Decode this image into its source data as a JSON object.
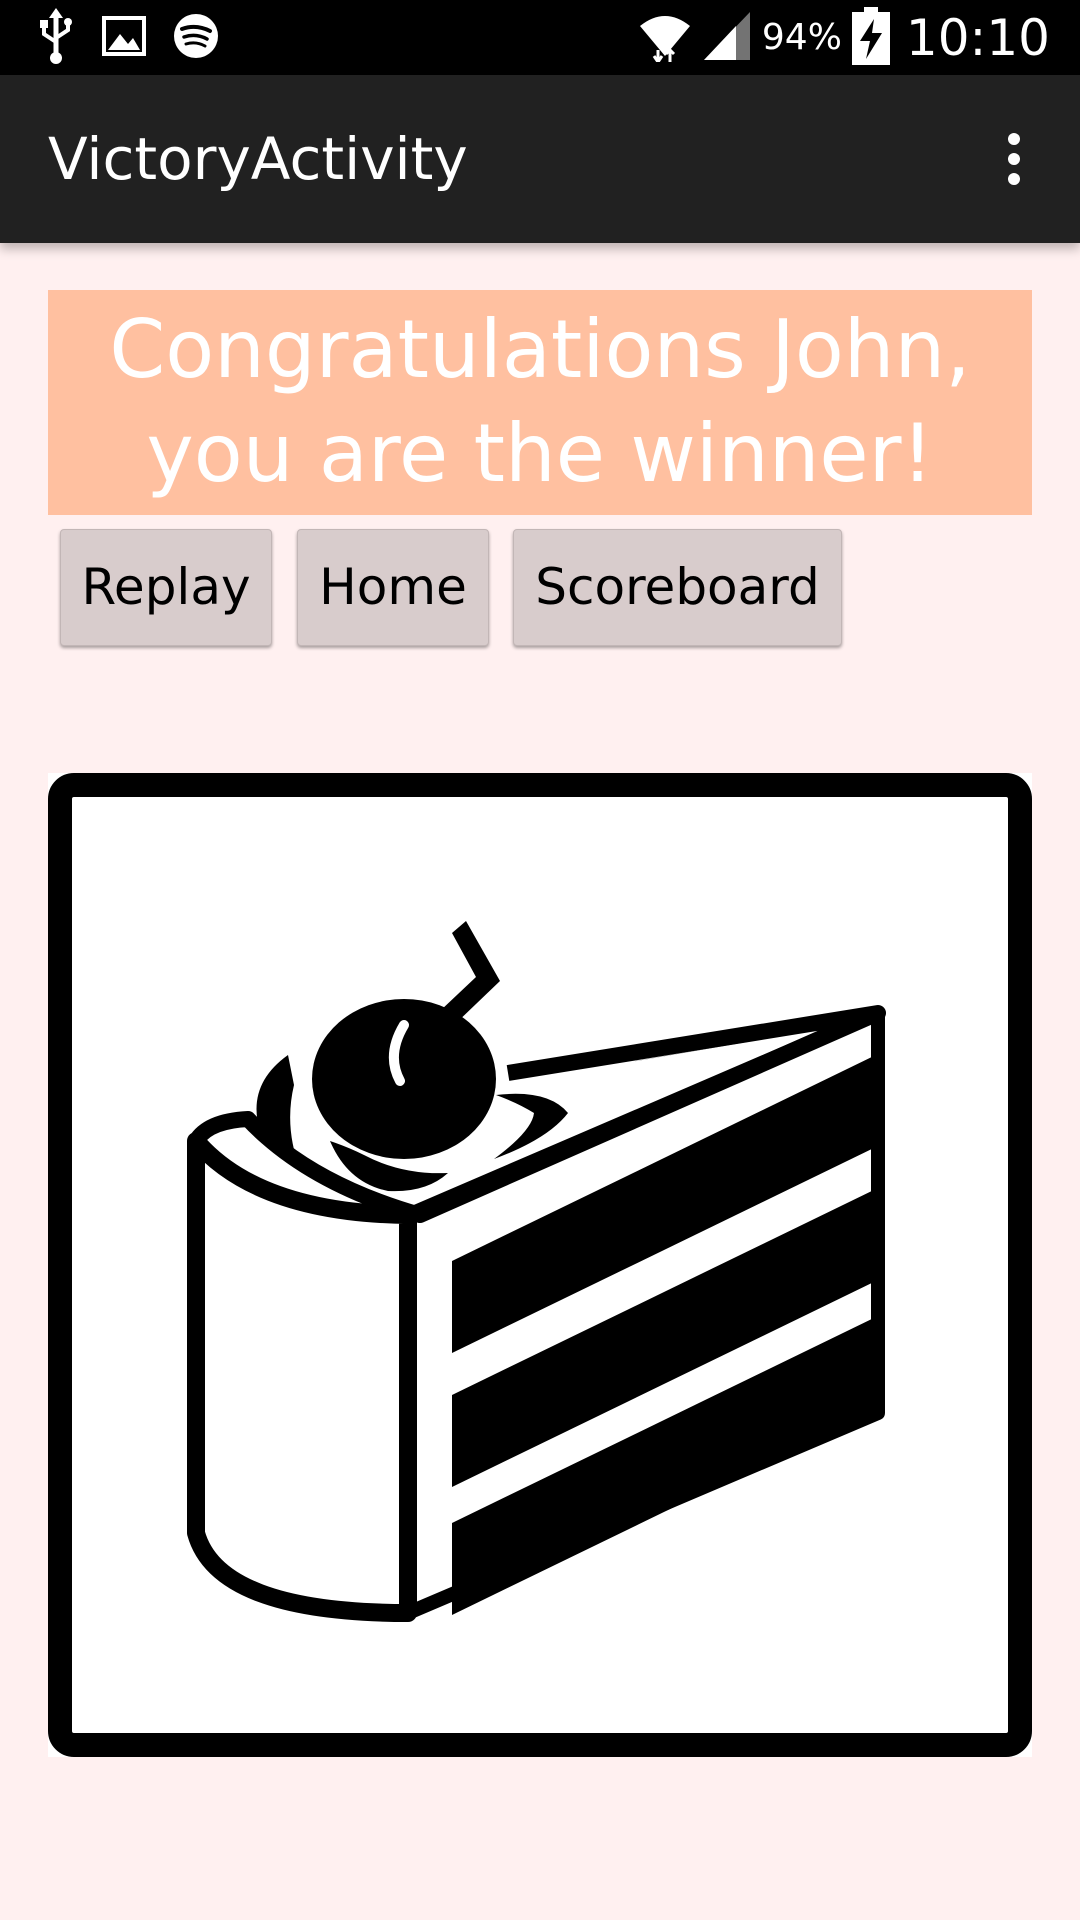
{
  "status_bar": {
    "icons_left": [
      "usb-icon",
      "image-icon",
      "spotify-icon"
    ],
    "icons_right": [
      "wifi-icon",
      "signal-icon",
      "battery-charging-icon"
    ],
    "battery": "94%",
    "time": "10:10"
  },
  "app_bar": {
    "title": "VictoryActivity",
    "menu_icon": "overflow-menu-icon"
  },
  "banner": {
    "line1": "Congratulations John,",
    "line2": "you are the winner!",
    "background": "#ffc0a0",
    "text_color": "#ffffff"
  },
  "buttons": {
    "replay": "Replay",
    "home": "Home",
    "scoreboard": "Scoreboard"
  },
  "image": {
    "icon": "cake-icon"
  },
  "colors": {
    "page_background": "#fff0f0",
    "app_bar": "#212121",
    "button": "#d8cccc"
  }
}
